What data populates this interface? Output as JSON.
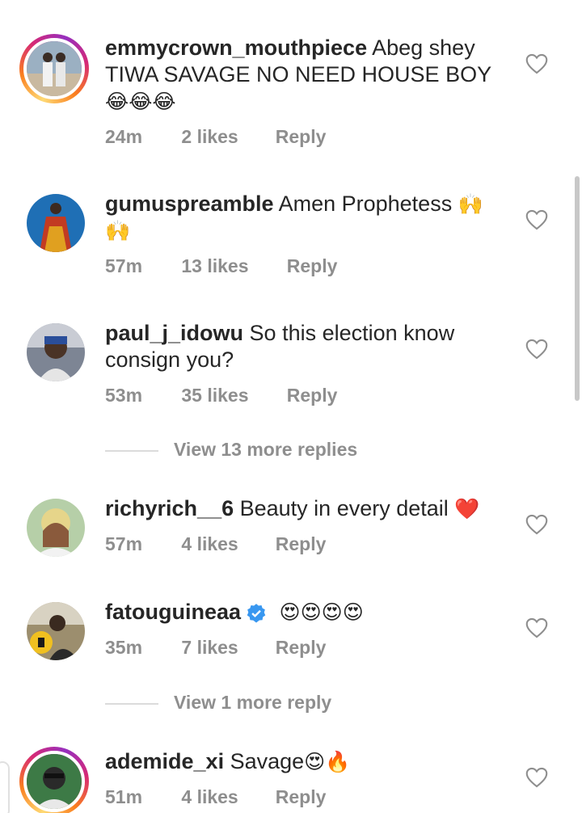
{
  "comments": [
    {
      "username": "emmycrown_mouthpiece",
      "text": "Abeg shey TIWA SAVAGE NO NEED HOUSE BOY",
      "emoji": "😂😂😂",
      "time": "24m",
      "likes": "2 likes",
      "reply": "Reply",
      "has_story": true,
      "avatar_color": "#8fa6b8"
    },
    {
      "username": "gumuspreamble",
      "text": "Amen Prophetess",
      "emoji": "🙌🙌",
      "time": "57m",
      "likes": "13 likes",
      "reply": "Reply",
      "has_story": false,
      "avatar_color": "#1f6fb5"
    },
    {
      "username": "paul_j_idowu",
      "text": "So this election know consign you?",
      "emoji": "",
      "time": "53m",
      "likes": "35 likes",
      "reply": "Reply",
      "has_story": false,
      "avatar_color": "#6a7080"
    },
    {
      "username": "richyrich__6",
      "text": "Beauty in every detail",
      "emoji": "❤️",
      "time": "57m",
      "likes": "4 likes",
      "reply": "Reply",
      "has_story": false,
      "avatar_color": "#b6cfa8"
    },
    {
      "username": "fatouguineaa",
      "text": "",
      "emoji": "😍😍😍😍",
      "time": "35m",
      "likes": "7 likes",
      "reply": "Reply",
      "has_story": false,
      "verified": true,
      "avatar_color": "#5a5040"
    },
    {
      "username": "ademide_xi",
      "text": "Savage",
      "emoji": "😍🔥",
      "time": "51m",
      "likes": "4 likes",
      "reply": "Reply",
      "has_story": true,
      "avatar_color": "#2f6b3a"
    }
  ],
  "view_more": [
    {
      "label": "View 13 more replies"
    },
    {
      "label": "View 1 more reply"
    }
  ],
  "colors": {
    "text": "#262626",
    "meta": "#8e8e8e",
    "divider": "#dbdbdb",
    "verified": "#3897f0"
  }
}
